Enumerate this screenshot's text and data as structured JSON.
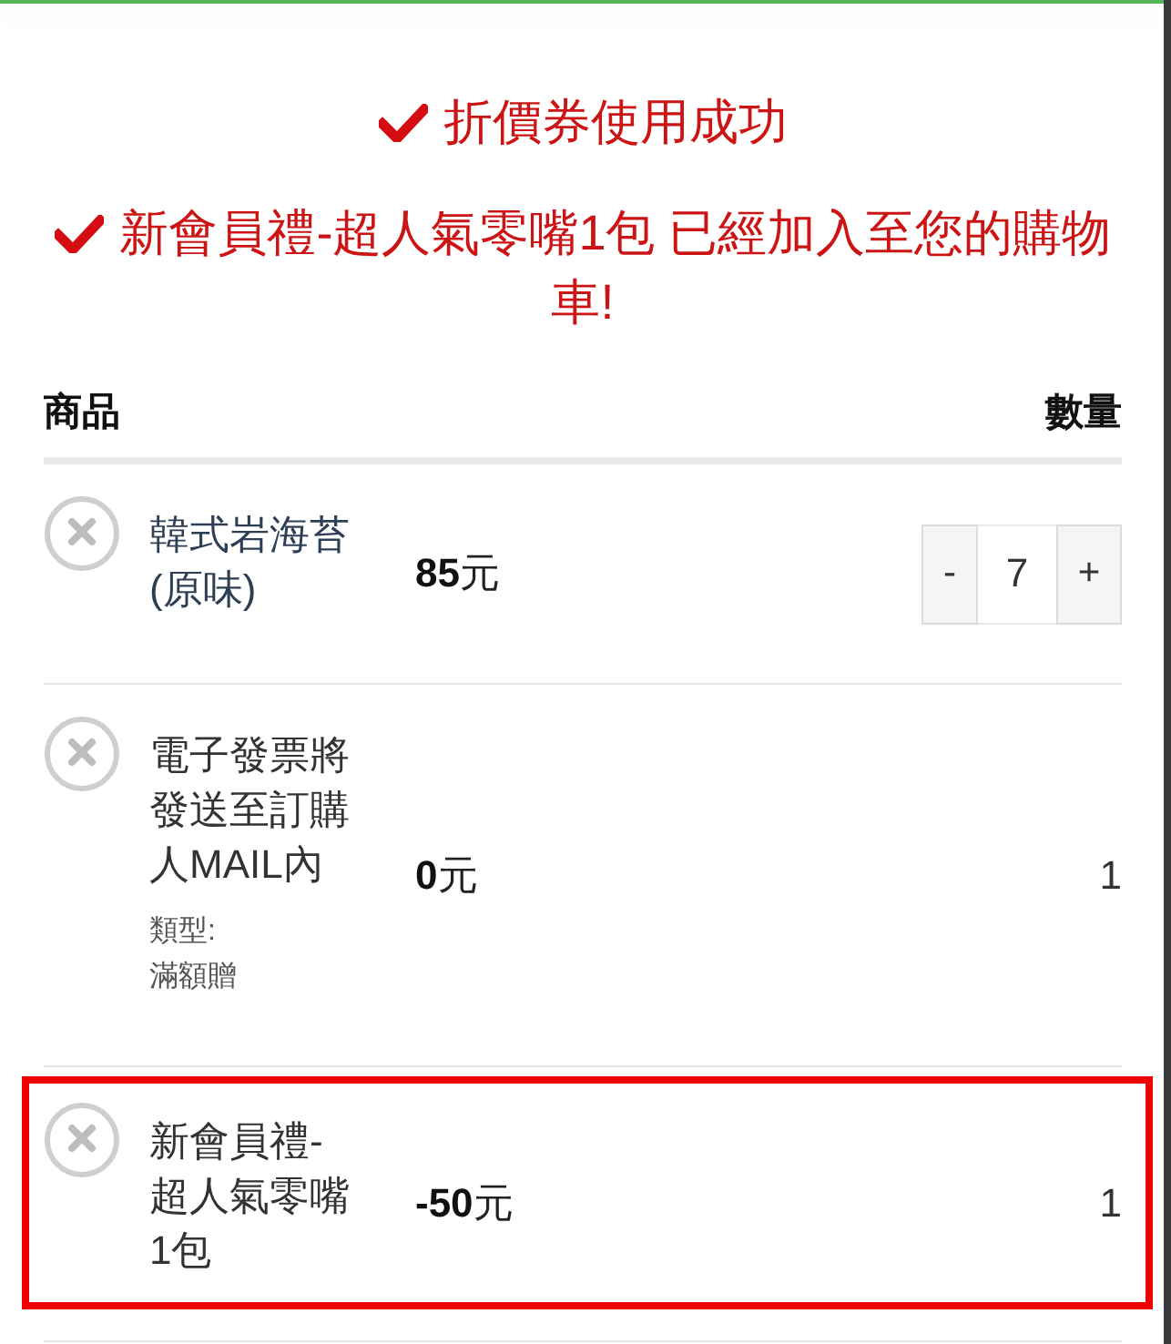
{
  "messages": [
    {
      "text": "折價券使用成功"
    },
    {
      "text": "新會員禮-超人氣零嘴1包 已經加入至您的購物車!"
    }
  ],
  "cart": {
    "columns": [
      "商品",
      "數量"
    ],
    "rows": [
      {
        "kind": "product",
        "name": "韓式岩海苔(原味)",
        "price": "**85**元",
        "quantity": {
          "decrease": "-",
          "value": "7",
          "increase": "+"
        },
        "highlighted": false
      },
      {
        "kind": "gift",
        "name": "電子發票將發送至訂購人MAIL內",
        "details": [
          {
            "label": "類型:",
            "value": "滿額贈"
          }
        ],
        "price": "**0**元",
        "quantity": {
          "value": "1"
        },
        "highlighted": false
      },
      {
        "kind": "gift",
        "name": "新會員禮-超人氣零嘴1包",
        "price": "**-50**元",
        "quantity": {
          "value": "1"
        },
        "highlighted": true
      }
    ]
  }
}
